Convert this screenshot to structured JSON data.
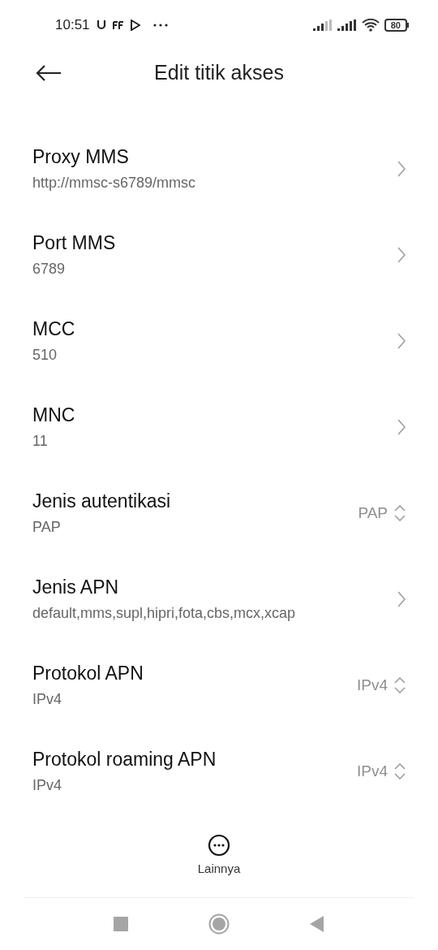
{
  "status_bar": {
    "time": "10:51",
    "battery": "80"
  },
  "header": {
    "title": "Edit titik akses"
  },
  "items": [
    {
      "kind": "link",
      "title": "Proxy MMS",
      "value": "http://mmsc-s6789/mmsc"
    },
    {
      "kind": "link",
      "title": "Port MMS",
      "value": "6789"
    },
    {
      "kind": "link",
      "title": "MCC",
      "value": "510"
    },
    {
      "kind": "link",
      "title": "MNC",
      "value": "11"
    },
    {
      "kind": "select",
      "title": "Jenis autentikasi",
      "value": "PAP",
      "selection": "PAP"
    },
    {
      "kind": "link",
      "title": "Jenis APN",
      "value": "default,mms,supl,hipri,fota,cbs,mcx,xcap"
    },
    {
      "kind": "select",
      "title": "Protokol APN",
      "value": "IPv4",
      "selection": "IPv4"
    },
    {
      "kind": "select",
      "title": "Protokol roaming APN",
      "value": "IPv4",
      "selection": "IPv4"
    }
  ],
  "more_button": {
    "label": "Lainnya"
  }
}
